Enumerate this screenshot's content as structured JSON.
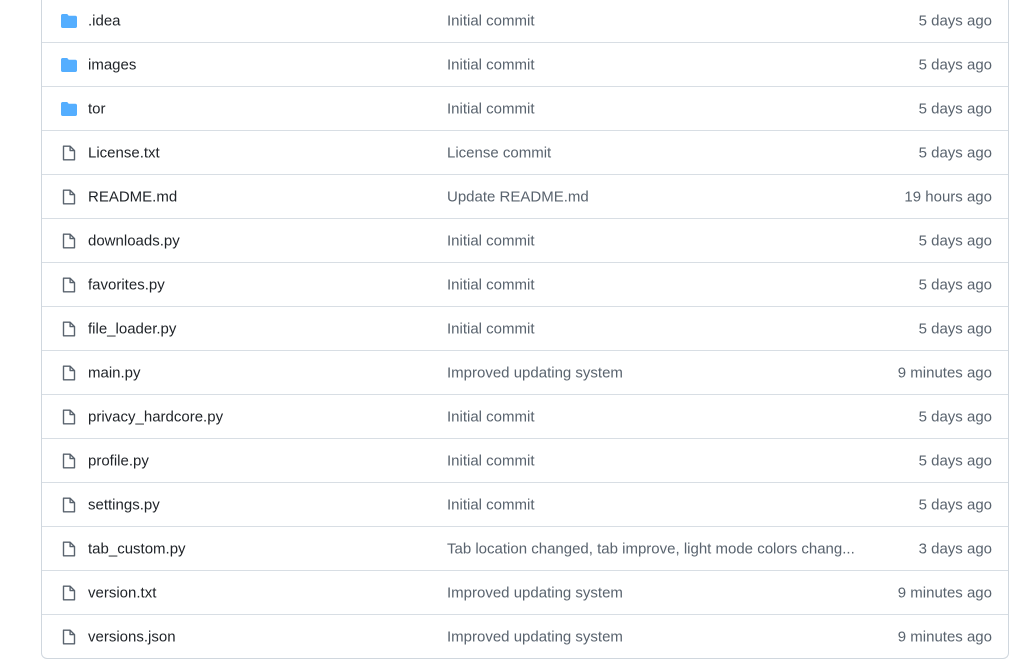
{
  "colors": {
    "folder_icon": "#54aeff",
    "file_icon": "#59636e",
    "name_text": "#1f2328",
    "muted_text": "#59636e",
    "border": "#d0d7de"
  },
  "files": [
    {
      "icon": "folder-icon",
      "name": ".idea",
      "commit": "Initial commit",
      "age": "5 days ago"
    },
    {
      "icon": "folder-icon",
      "name": "images",
      "commit": "Initial commit",
      "age": "5 days ago"
    },
    {
      "icon": "folder-icon",
      "name": "tor",
      "commit": "Initial commit",
      "age": "5 days ago"
    },
    {
      "icon": "file-icon",
      "name": "License.txt",
      "commit": "License commit",
      "age": "5 days ago"
    },
    {
      "icon": "file-icon",
      "name": "README.md",
      "commit": "Update README.md",
      "age": "19 hours ago"
    },
    {
      "icon": "file-icon",
      "name": "downloads.py",
      "commit": "Initial commit",
      "age": "5 days ago"
    },
    {
      "icon": "file-icon",
      "name": "favorites.py",
      "commit": "Initial commit",
      "age": "5 days ago"
    },
    {
      "icon": "file-icon",
      "name": "file_loader.py",
      "commit": "Initial commit",
      "age": "5 days ago"
    },
    {
      "icon": "file-icon",
      "name": "main.py",
      "commit": "Improved updating system",
      "age": "9 minutes ago"
    },
    {
      "icon": "file-icon",
      "name": "privacy_hardcore.py",
      "commit": "Initial commit",
      "age": "5 days ago"
    },
    {
      "icon": "file-icon",
      "name": "profile.py",
      "commit": "Initial commit",
      "age": "5 days ago"
    },
    {
      "icon": "file-icon",
      "name": "settings.py",
      "commit": "Initial commit",
      "age": "5 days ago"
    },
    {
      "icon": "file-icon",
      "name": "tab_custom.py",
      "commit": "Tab location changed, tab improve, light mode colors chang...",
      "age": "3 days ago"
    },
    {
      "icon": "file-icon",
      "name": "version.txt",
      "commit": "Improved updating system",
      "age": "9 minutes ago"
    },
    {
      "icon": "file-icon",
      "name": "versions.json",
      "commit": "Improved updating system",
      "age": "9 minutes ago"
    }
  ]
}
